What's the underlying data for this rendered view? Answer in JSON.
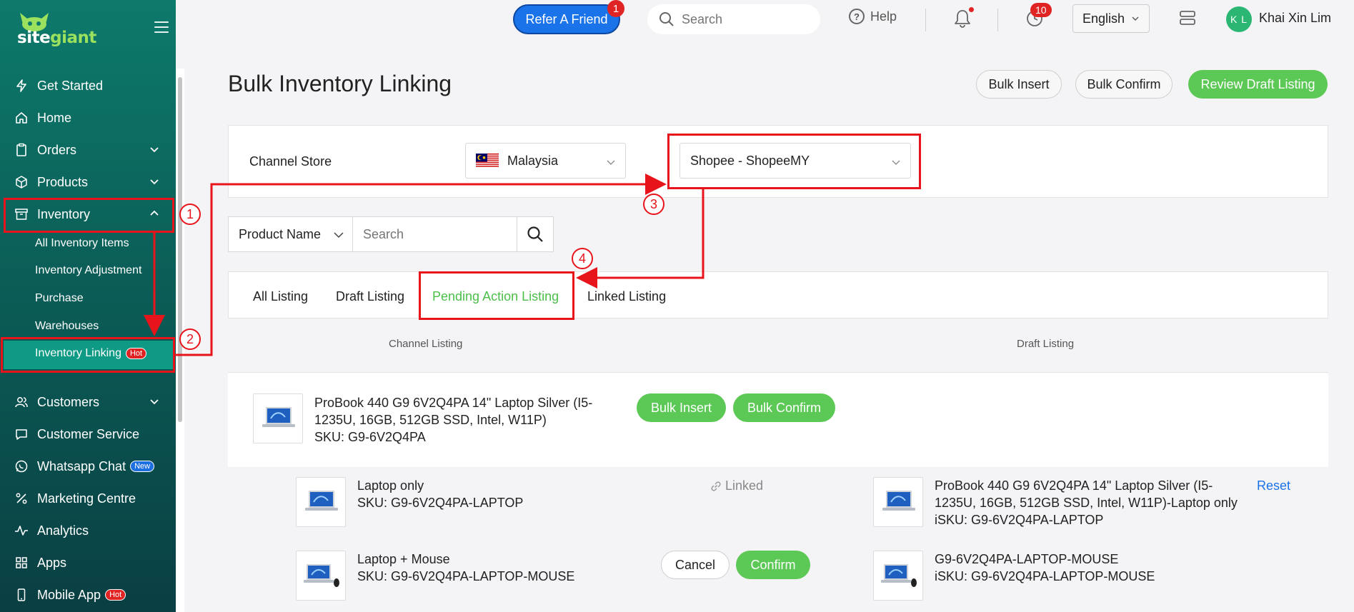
{
  "sidebar": {
    "logo": "sitegiant",
    "items": [
      {
        "label": "Get Started",
        "icon": "lightning-icon"
      },
      {
        "label": "Home",
        "icon": "home-icon"
      },
      {
        "label": "Orders",
        "icon": "clipboard-icon"
      },
      {
        "label": "Products",
        "icon": "box-icon"
      },
      {
        "label": "Inventory",
        "icon": "archive-icon"
      },
      {
        "label": "Customers",
        "icon": "users-icon"
      },
      {
        "label": "Customer Service",
        "icon": "chat-icon"
      },
      {
        "label": "Whatsapp Chat",
        "icon": "whatsapp-icon",
        "badge": "New"
      },
      {
        "label": "Marketing Centre",
        "icon": "percent-icon"
      },
      {
        "label": "Analytics",
        "icon": "pulse-icon"
      },
      {
        "label": "Apps",
        "icon": "grid-icon"
      },
      {
        "label": "Mobile App",
        "icon": "phone-icon",
        "badge": "Hot"
      }
    ],
    "inventory_sub": [
      {
        "label": "All Inventory Items"
      },
      {
        "label": "Inventory Adjustment"
      },
      {
        "label": "Purchase"
      },
      {
        "label": "Warehouses"
      },
      {
        "label": "Inventory Linking",
        "badge": "Hot"
      }
    ]
  },
  "topbar": {
    "refer_label": "Refer A Friend",
    "refer_badge": "1",
    "search_placeholder": "Search",
    "help_label": "Help",
    "notif_count": "10",
    "language": "English",
    "avatar_initials": "K L",
    "user_name": "Khai Xin Lim"
  },
  "page": {
    "title": "Bulk Inventory Linking",
    "bulk_insert": "Bulk Insert",
    "bulk_confirm": "Bulk Confirm",
    "review_draft": "Review Draft Listing"
  },
  "channel": {
    "label": "Channel Store",
    "country": "Malaysia",
    "store": "Shopee - ShopeeMY"
  },
  "filter": {
    "field": "Product Name",
    "placeholder": "Search"
  },
  "tabs": [
    "All Listing",
    "Draft Listing",
    "Pending Action Listing",
    "Linked Listing"
  ],
  "columns": {
    "left": "Channel Listing",
    "right": "Draft Listing"
  },
  "product": {
    "name_line1": "ProBook 440 G9 6V2Q4PA 14\" Laptop Silver (I5-",
    "name_line2": "1235U, 16GB, 512GB SSD, Intel, W11P)",
    "sku": "SKU: G9-6V2Q4PA",
    "bulk_insert": "Bulk Insert",
    "bulk_confirm": "Bulk Confirm"
  },
  "variants": [
    {
      "name": "Laptop only",
      "sku": "SKU: G9-6V2Q4PA-LAPTOP",
      "status": "Linked",
      "draft_line1": "ProBook 440 G9 6V2Q4PA 14\" Laptop Silver (I5-",
      "draft_line2": "1235U, 16GB, 512GB SSD, Intel, W11P)-Laptop only",
      "draft_sku": "iSKU: G9-6V2Q4PA-LAPTOP",
      "action": "Reset"
    },
    {
      "name": "Laptop + Mouse",
      "sku": "SKU: G9-6V2Q4PA-LAPTOP-MOUSE",
      "cancel": "Cancel",
      "confirm": "Confirm",
      "draft_line1": "G9-6V2Q4PA-LAPTOP-MOUSE",
      "draft_sku": "iSKU: G9-6V2Q4PA-LAPTOP-MOUSE"
    }
  ],
  "annotations": [
    "1",
    "2",
    "3",
    "4"
  ],
  "colors": {
    "accent_green": "#5cc855",
    "annotation_red": "#e8141b",
    "sidebar_teal": "#0d7a6b",
    "link_blue": "#1a73e8"
  }
}
